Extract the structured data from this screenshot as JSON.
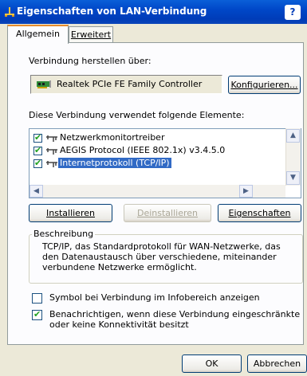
{
  "window": {
    "title": "Eigenschaften von LAN-Verbindung",
    "help_label": "?"
  },
  "tabs": [
    {
      "label": "Allgemein",
      "active": true
    },
    {
      "label": "Erweitert",
      "active": false
    }
  ],
  "connect_using": {
    "label": "Verbindung herstellen über:",
    "adapter": "Realtek PCIe FE Family Controller",
    "configure_button": "Konfigurieren..."
  },
  "components": {
    "label": "Diese Verbindung verwendet folgende Elemente:",
    "items": [
      {
        "label": "Netzwerkmonitortreiber",
        "checked": true,
        "selected": false
      },
      {
        "label": "AEGIS Protocol (IEEE 802.1x) v3.4.5.0",
        "checked": true,
        "selected": false
      },
      {
        "label": "Internetprotokoll (TCP/IP)",
        "checked": true,
        "selected": true
      }
    ]
  },
  "actions": {
    "install": "Installieren",
    "uninstall": "Deinstallieren",
    "properties": "Eigenschaften"
  },
  "description": {
    "legend": "Beschreibung",
    "text": "TCP/IP, das Standardprotokoll für WAN-Netzwerke, das den Datenaustausch über verschiedene, miteinander verbundene Netzwerke ermöglicht."
  },
  "options": [
    {
      "label": "Symbol bei Verbindung im Infobereich anzeigen",
      "checked": false
    },
    {
      "label": "Benachrichtigen, wenn diese Verbindung eingeschränkte oder keine Konnektivität besitzt",
      "checked": true
    }
  ],
  "footer": {
    "ok": "OK",
    "cancel": "Abbrechen"
  },
  "icons": {
    "title": "network-connection-icon",
    "adapter": "network-card-icon",
    "component": "network-component-icon"
  },
  "colors": {
    "titlebar": "#0047c8",
    "selection": "#316ac5",
    "dialog": "#ece9d8",
    "check": "#21a121"
  }
}
